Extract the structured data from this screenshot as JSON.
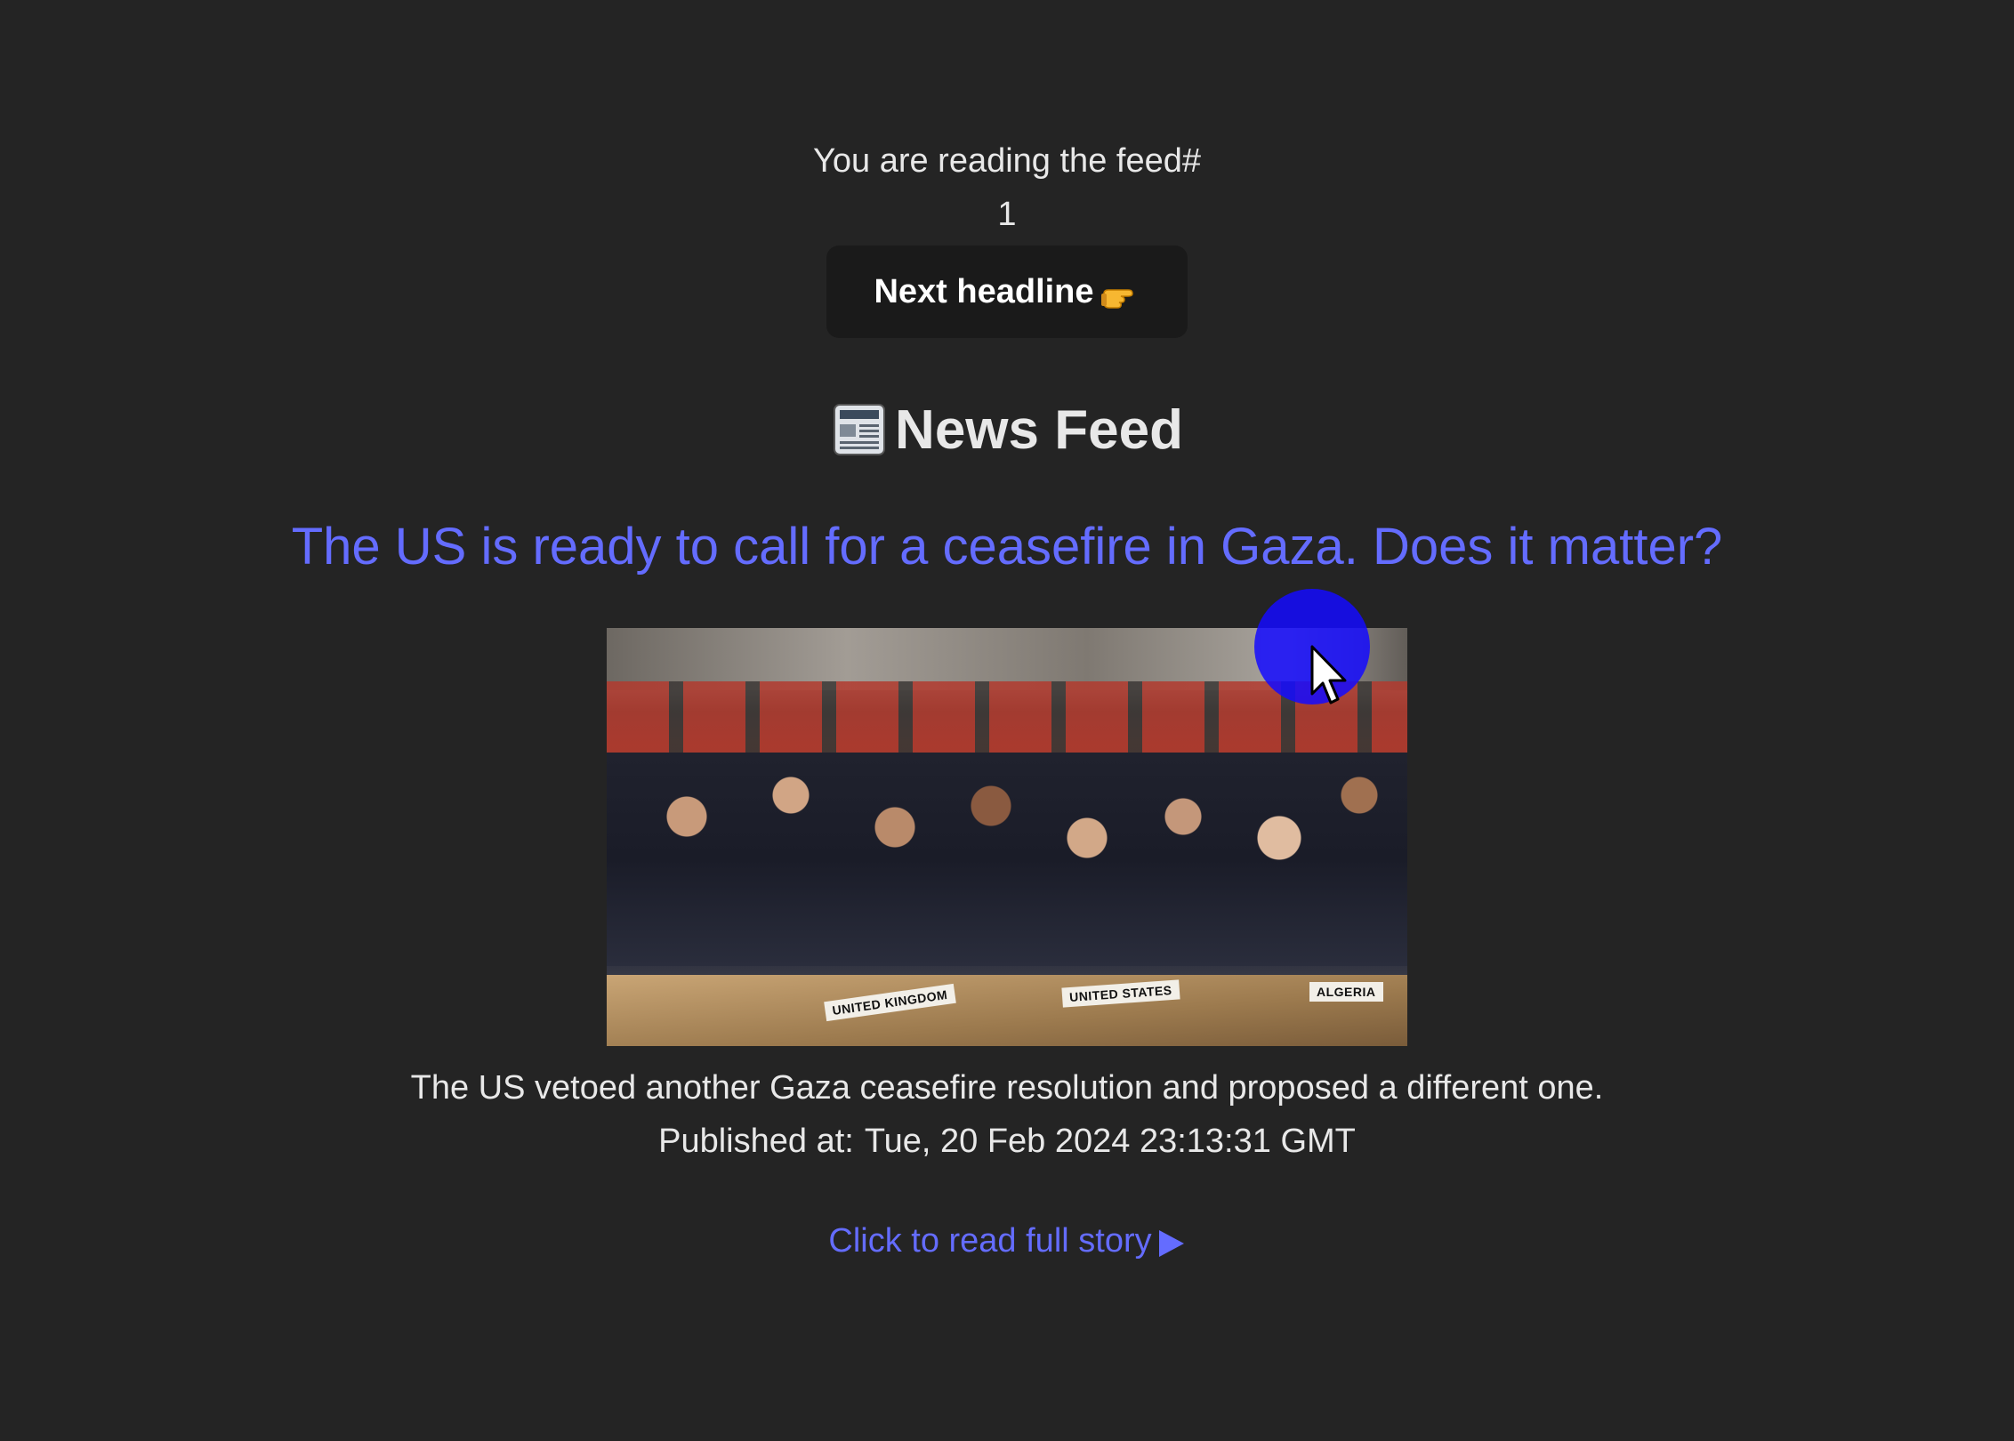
{
  "feed": {
    "label": "You are reading the feed#",
    "number": "1",
    "next_button_label": "Next headline"
  },
  "page": {
    "title": "News Feed",
    "title_icon": "newspaper-icon"
  },
  "article": {
    "headline": "The US is ready to call for a ceasefire in Gaza. Does it matter?",
    "description": "The US vetoed another Gaza ceasefire resolution and proposed a different one.",
    "published_label": "Published at:",
    "published_date": "Tue, 20 Feb 2024 23:13:31 GMT",
    "read_more_label": "Click to read full story",
    "image": {
      "name_plates": [
        "UNITED KINGDOM",
        "UNITED STATES",
        "ALGERIA"
      ]
    }
  },
  "colors": {
    "background": "#242424",
    "accent": "#646cff",
    "button_bg": "#1a1a1a",
    "cursor_highlight": "#140aff"
  },
  "icons": {
    "next_button": "pointing-hand-icon",
    "read_more": "play-icon",
    "cursor": "mouse-cursor-icon"
  }
}
